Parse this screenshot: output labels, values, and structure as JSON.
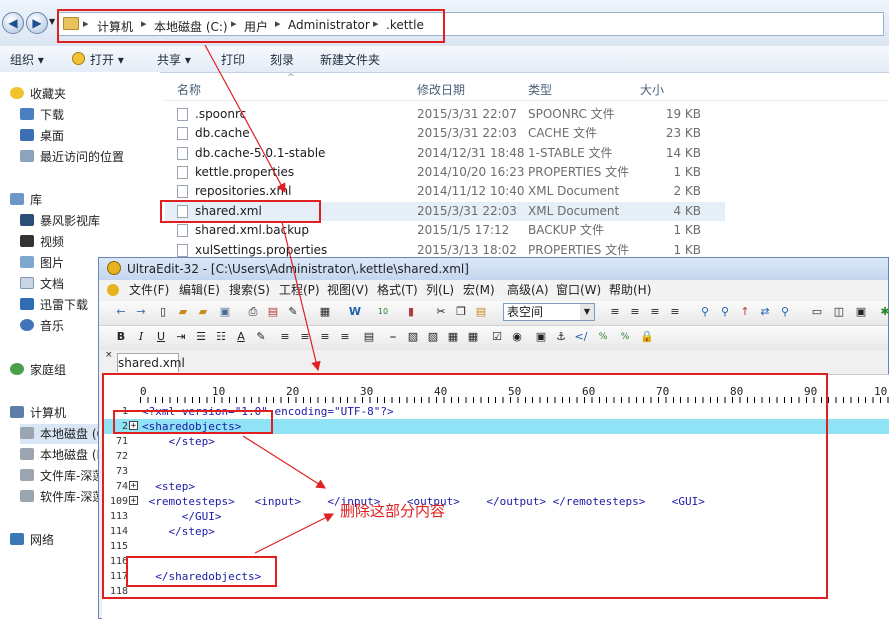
{
  "explorer": {
    "breadcrumbs": [
      "计算机",
      "本地磁盘 (C:)",
      "用户",
      "Administrator",
      ".kettle"
    ],
    "toolbar": [
      "组织 ▾",
      "打开 ▾",
      "共享 ▾",
      "打印",
      "刻录",
      "新建文件夹"
    ],
    "nav": {
      "favorites": "收藏夹",
      "fav_items": [
        "下载",
        "桌面",
        "最近访问的位置"
      ],
      "libraries": "库",
      "lib_items": [
        "暴风影视库",
        "视频",
        "图片",
        "文档",
        "迅雷下载",
        "音乐"
      ],
      "homegroup": "家庭组",
      "computer": "计算机",
      "drives": [
        "本地磁盘 (C",
        "本地磁盘 (D",
        "文件库-深莲",
        "软件库-深莲"
      ],
      "network": "网络"
    },
    "columns": [
      "名称",
      "修改日期",
      "类型",
      "大小"
    ],
    "files": [
      {
        "name": ".spoonrc",
        "date": "2015/3/31 22:07",
        "type": "SPOONRC 文件",
        "size": "19 KB"
      },
      {
        "name": "db.cache",
        "date": "2015/3/31 22:03",
        "type": "CACHE 文件",
        "size": "23 KB"
      },
      {
        "name": "db.cache-5.0.1-stable",
        "date": "2014/12/31 18:48",
        "type": "1-STABLE 文件",
        "size": "14 KB"
      },
      {
        "name": "kettle.properties",
        "date": "2014/10/20 16:23",
        "type": "PROPERTIES 文件",
        "size": "1 KB"
      },
      {
        "name": "repositories.xml",
        "date": "2014/11/12 10:40",
        "type": "XML Document",
        "size": "2 KB"
      },
      {
        "name": "shared.xml",
        "date": "2015/3/31 22:03",
        "type": "XML Document",
        "size": "4 KB"
      },
      {
        "name": "shared.xml.backup",
        "date": "2015/1/5 17:12",
        "type": "BACKUP 文件",
        "size": "1 KB"
      },
      {
        "name": "xulSettings.properties",
        "date": "2015/3/13 18:02",
        "type": "PROPERTIES 文件",
        "size": "1 KB"
      }
    ]
  },
  "ultraedit": {
    "title": "UltraEdit-32 - [C:\\Users\\Administrator\\.kettle\\shared.xml]",
    "menu": [
      "文件(F)",
      "编辑(E)",
      "搜索(S)",
      "工程(P)",
      "视图(V)",
      "格式(T)",
      "列(L)",
      "宏(M)",
      "高级(A)",
      "窗口(W)",
      "帮助(H)"
    ],
    "font_combo": "表空间",
    "tab": "shared.xml",
    "ruler": [
      "0",
      "10",
      "20",
      "30",
      "40",
      "50",
      "60",
      "70",
      "80",
      "90",
      "10"
    ],
    "lines": [
      {
        "num": "1",
        "fold": "",
        "text": "<?xml version=\"1.0\" encoding=\"UTF-8\"?>"
      },
      {
        "num": "2",
        "fold": "+",
        "text": "<sharedobjects>"
      },
      {
        "num": "71",
        "fold": "",
        "text": "    </step>"
      },
      {
        "num": "72",
        "fold": "",
        "text": ""
      },
      {
        "num": "73",
        "fold": "",
        "text": ""
      },
      {
        "num": "74",
        "fold": "+",
        "text": "  <step>"
      },
      {
        "num": "109",
        "fold": "+",
        "text": " <remotesteps>   <input>    </input>    <output>    </output> </remotesteps>    <GUI>"
      },
      {
        "num": "113",
        "fold": "",
        "text": "      </GUI>"
      },
      {
        "num": "114",
        "fold": "",
        "text": "    </step>"
      },
      {
        "num": "115",
        "fold": "",
        "text": ""
      },
      {
        "num": "116",
        "fold": "",
        "text": ""
      },
      {
        "num": "117",
        "fold": "",
        "text": "  </sharedobjects>"
      },
      {
        "num": "118",
        "fold": "",
        "text": ""
      }
    ],
    "annotation": "删除这部分内容"
  },
  "colors": {
    "highlight": "#8fe3f5",
    "annotation": "#e02020",
    "code": "#1a1aa6"
  }
}
